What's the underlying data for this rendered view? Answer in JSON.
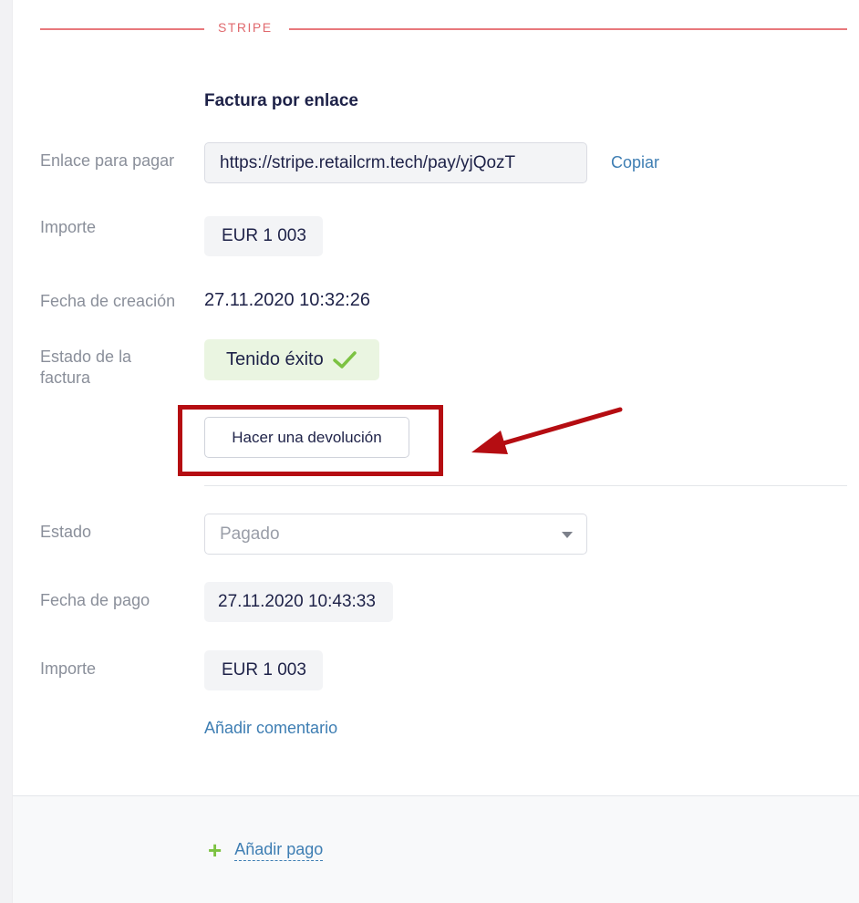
{
  "section": {
    "title": "STRIPE"
  },
  "invoice": {
    "subtitle": "Factura por enlace",
    "pay_link": {
      "label": "Enlace para pagar",
      "value": "https://stripe.retailcrm.tech/pay/yjQozT",
      "copy_label": "Copiar"
    },
    "amount": {
      "label": "Importe",
      "value": "EUR 1 003"
    },
    "created": {
      "label": "Fecha de creación",
      "value": "27.11.2020 10:32:26"
    },
    "status": {
      "label_line1": "Estado de la",
      "label_line2": "factura",
      "value": "Tenido éxito"
    },
    "refund_button": "Hacer una devolución"
  },
  "payment": {
    "state": {
      "label": "Estado",
      "value": "Pagado"
    },
    "paid_date": {
      "label": "Fecha de pago",
      "value": "27.11.2020 10:43:33"
    },
    "amount": {
      "label": "Importe",
      "value": "EUR 1 003"
    },
    "add_comment": "Añadir comentario"
  },
  "footer": {
    "add_payment": "Añadir pago"
  },
  "colors": {
    "accent_red": "#e06a6e",
    "link_blue": "#3e7eb3",
    "success_green": "#7cc242",
    "highlight_red": "#b50d12"
  },
  "icons": {
    "status": "check-icon",
    "add": "plus-icon",
    "select": "caret-down-icon",
    "annotation": "arrow-annotation"
  }
}
